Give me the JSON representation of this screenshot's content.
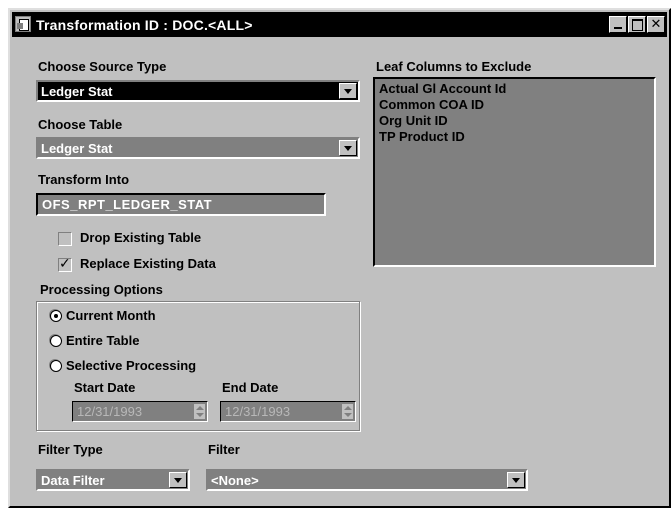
{
  "window": {
    "title": "Transformation ID : DOC.<ALL>",
    "close_glyph": "✕"
  },
  "source_type": {
    "label": "Choose Source Type",
    "value": "Ledger Stat"
  },
  "table": {
    "label": "Choose Table",
    "value": "Ledger Stat"
  },
  "transform": {
    "label": "Transform Into",
    "value": "OFS_RPT_LEDGER_STAT"
  },
  "drop_existing": {
    "label": "Drop Existing Table",
    "checked": false
  },
  "replace_existing": {
    "label": "Replace Existing Data",
    "checked": true,
    "mark": "✓"
  },
  "processing": {
    "label": "Processing Options",
    "options": [
      {
        "label": "Current Month",
        "selected": true
      },
      {
        "label": "Entire Table",
        "selected": false
      },
      {
        "label": "Selective Processing",
        "selected": false
      }
    ],
    "start_label": "Start Date",
    "start_value": "12/31/1993",
    "end_label": "End Date",
    "end_value": "12/31/1993"
  },
  "filter_type": {
    "label": "Filter Type",
    "value": "Data Filter"
  },
  "filter": {
    "label": "Filter",
    "value": "<None>"
  },
  "leaf_columns": {
    "label": "Leaf Columns to Exclude",
    "items": [
      "Actual Gl Account Id",
      "Common COA ID",
      "Org Unit ID",
      "TP Product ID"
    ]
  },
  "colors": {
    "window_bg": "#c0c0c0",
    "field_bg": "#808080",
    "titlebar": "#000000"
  },
  "icons": [
    "app-icon",
    "minimize-icon",
    "maximize-icon",
    "close-icon",
    "chevron-down-icon",
    "spinner-icon"
  ]
}
